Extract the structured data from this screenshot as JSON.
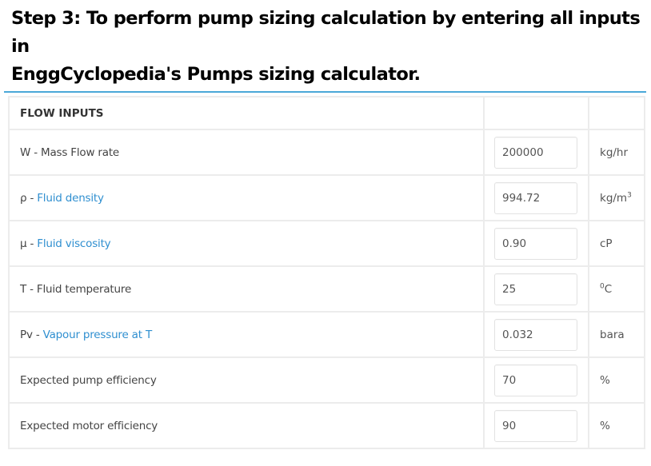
{
  "heading": {
    "line1": "Step 3: To perform pump sizing calculation by entering all inputs in",
    "line2": "EnggCyclopedia's Pumps sizing calculator."
  },
  "colors": {
    "accent_rule": "#4aa8d8",
    "link": "#2f8fd0",
    "border": "#ececec"
  },
  "section": {
    "title": "FLOW INPUTS"
  },
  "rows": [
    {
      "symbol": "W - ",
      "label": "Mass Flow rate",
      "label_is_link": false,
      "value": "200000",
      "unit": "kg/hr",
      "unit_sup": ""
    },
    {
      "symbol": "ρ - ",
      "label": "Fluid density",
      "label_is_link": true,
      "value": "994.72",
      "unit": "kg/m",
      "unit_sup": "3"
    },
    {
      "symbol": "μ - ",
      "label": "Fluid viscosity",
      "label_is_link": true,
      "value": "0.90",
      "unit": "cP",
      "unit_sup": ""
    },
    {
      "symbol": "T - ",
      "label": "Fluid temperature",
      "label_is_link": false,
      "value": "25",
      "unit_prefix_sup": "0",
      "unit": "C",
      "unit_sup": ""
    },
    {
      "symbol": "Pv - ",
      "label": "Vapour pressure at T",
      "label_is_link": true,
      "value": "0.032",
      "unit": "bara",
      "unit_sup": ""
    },
    {
      "symbol": "",
      "label": "Expected pump efficiency",
      "label_is_link": false,
      "value": "70",
      "unit": "%",
      "unit_sup": ""
    },
    {
      "symbol": "",
      "label": "Expected motor efficiency",
      "label_is_link": false,
      "value": "90",
      "unit": "%",
      "unit_sup": ""
    }
  ]
}
